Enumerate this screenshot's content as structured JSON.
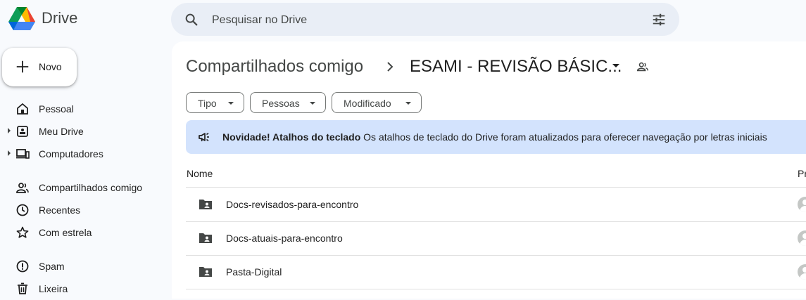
{
  "app": {
    "name": "Drive"
  },
  "search": {
    "placeholder": "Pesquisar no Drive"
  },
  "new_button": {
    "label": "Novo"
  },
  "sidebar": {
    "items": [
      {
        "label": "Pessoal",
        "icon": "home-icon"
      },
      {
        "label": "Meu Drive",
        "icon": "my-drive-icon"
      },
      {
        "label": "Computadores",
        "icon": "computers-icon"
      },
      {
        "label": "Compartilhados comigo",
        "icon": "shared-icon"
      },
      {
        "label": "Recentes",
        "icon": "clock-icon"
      },
      {
        "label": "Com estrela",
        "icon": "star-icon"
      },
      {
        "label": "Spam",
        "icon": "spam-icon"
      },
      {
        "label": "Lixeira",
        "icon": "trash-icon"
      }
    ]
  },
  "breadcrumb": {
    "parent": "Compartilhados comigo",
    "current": "ESAMI - REVISÃO BÁSIC..."
  },
  "filters": {
    "type": "Tipo",
    "people": "Pessoas",
    "modified": "Modificado"
  },
  "banner": {
    "title": "Novidade! Atalhos do teclado",
    "text": "Os atalhos de teclado do Drive foram atualizados para oferecer navegação por letras iniciais"
  },
  "table": {
    "columns": {
      "name": "Nome",
      "owner": "Pr"
    },
    "rows": [
      {
        "name": "Docs-revisados-para-encontro"
      },
      {
        "name": "Docs-atuais-para-encontro"
      },
      {
        "name": "Pasta-Digital"
      }
    ]
  },
  "colors": {
    "accent": "#d3e3fd",
    "search_bg": "#e9eef6",
    "page_bg": "#f8fafd"
  }
}
